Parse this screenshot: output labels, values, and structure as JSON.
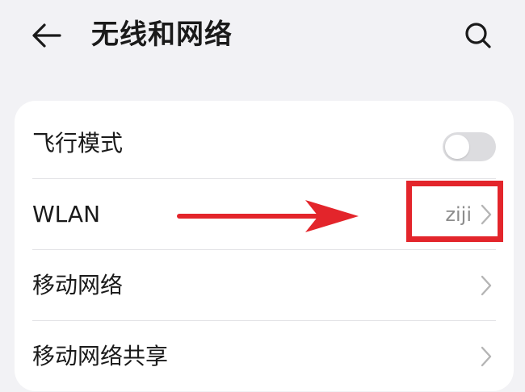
{
  "header": {
    "title": "无线和网络",
    "back_icon": "arrow-left-icon",
    "search_icon": "search-icon"
  },
  "settings": [
    {
      "label": "飞行模式",
      "control": "toggle",
      "toggle_on": false
    },
    {
      "label": "WLAN",
      "value": "ziji",
      "control": "chevron"
    },
    {
      "label": "移动网络",
      "control": "chevron"
    },
    {
      "label": "移动网络共享",
      "control": "chevron"
    }
  ],
  "annotation": {
    "arrow_color": "#e3252b",
    "box_color": "#e3252b"
  },
  "colors": {
    "background": "#f2f2f5",
    "card": "#ffffff",
    "secondary_text": "#8c8c8c",
    "toggle_off": "#dcdcdf"
  }
}
